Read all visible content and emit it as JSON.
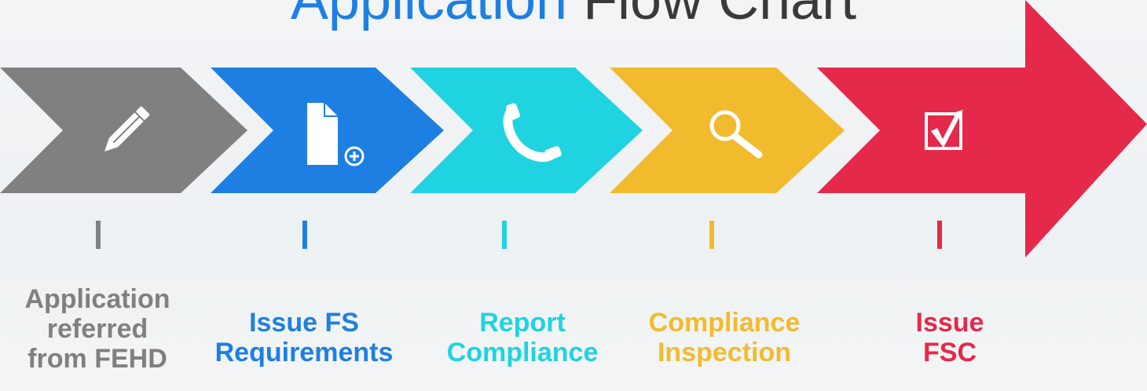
{
  "title": {
    "part1": "Application",
    "part2": "Flow Chart"
  },
  "steps": [
    {
      "label_lines": [
        "Application",
        "referred",
        "from FEHD"
      ],
      "icon": "pencil-icon",
      "color": "#808080"
    },
    {
      "label_lines": [
        "Issue FS",
        "Requirements"
      ],
      "icon": "add-document-icon",
      "color": "#1e7fe3"
    },
    {
      "label_lines": [
        "Report",
        "Compliance"
      ],
      "icon": "phone-icon",
      "color": "#1fd3e0"
    },
    {
      "label_lines": [
        "Compliance",
        "Inspection"
      ],
      "icon": "magnifier-icon",
      "color": "#f2bb2e"
    },
    {
      "label_lines": [
        "Issue",
        "FSC"
      ],
      "icon": "checkbox-icon",
      "color": "#e5294a"
    }
  ]
}
